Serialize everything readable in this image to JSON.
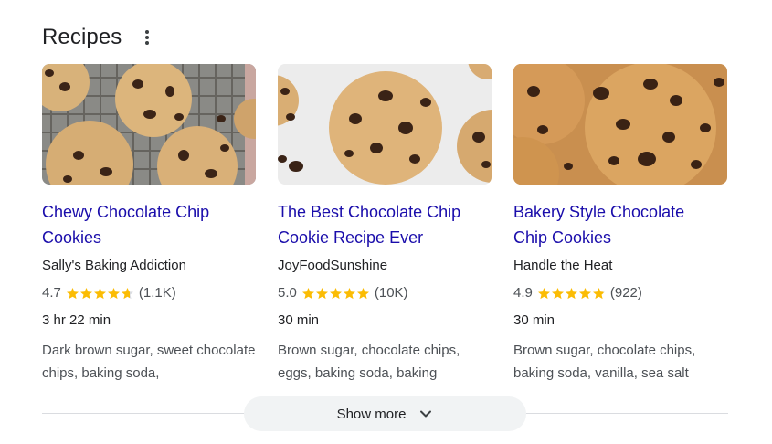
{
  "section": {
    "title": "Recipes"
  },
  "colors": {
    "star": "#fbbc04",
    "link": "#1a0dab"
  },
  "cards": [
    {
      "title_line1": "Chewy Chocolate Chip",
      "title_line2": "Cookies",
      "source": "Sally's Baking Addiction",
      "rating": "4.7",
      "rating_value": 4.7,
      "reviews": "(1.1K)",
      "time": "3 hr 22 min",
      "ingredients": "Dark brown sugar, sweet chocolate chips, baking soda,"
    },
    {
      "title_line1": "The Best Chocolate Chip",
      "title_line2": "Cookie Recipe Ever",
      "source": "JoyFoodSunshine",
      "rating": "5.0",
      "rating_value": 5.0,
      "reviews": "(10K)",
      "time": "30 min",
      "ingredients": "Brown sugar, chocolate chips, eggs, baking soda, baking"
    },
    {
      "title_line1": "Bakery Style Chocolate",
      "title_line2": "Chip Cookies",
      "source": "Handle the Heat",
      "rating": "4.9",
      "rating_value": 4.9,
      "reviews": "(922)",
      "time": "30 min",
      "ingredients": "Brown sugar, chocolate chips, baking soda, vanilla, sea salt"
    }
  ],
  "footer": {
    "show_more_label": "Show more"
  }
}
